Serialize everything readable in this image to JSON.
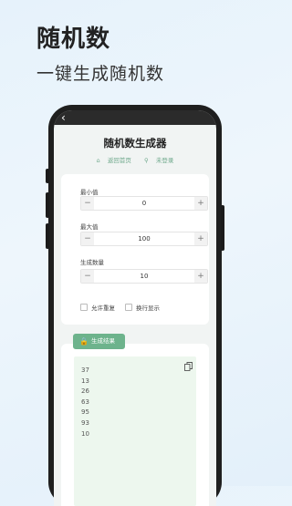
{
  "promo": {
    "headline": "随机数",
    "subhead": "一键生成随机数"
  },
  "app": {
    "title": "随机数生成器",
    "links": {
      "home": "返回首页",
      "login": "未登录"
    },
    "fields": [
      {
        "label": "最小值",
        "value": "0"
      },
      {
        "label": "最大值",
        "value": "100"
      },
      {
        "label": "生成数量",
        "value": "10"
      }
    ],
    "options": {
      "allow_repeat": "允许重复",
      "line_break": "换行显示"
    },
    "generate_label": "生成结果",
    "results": [
      "37",
      "13",
      "26",
      "63",
      "95",
      "93",
      "10"
    ],
    "icons": {
      "back": "back-arrow-icon",
      "home": "home-icon",
      "user": "user-icon",
      "lock": "lock-icon",
      "copy": "copy-icon"
    },
    "colors": {
      "accent": "#6db38c",
      "result_bg": "#edf7ee"
    }
  }
}
